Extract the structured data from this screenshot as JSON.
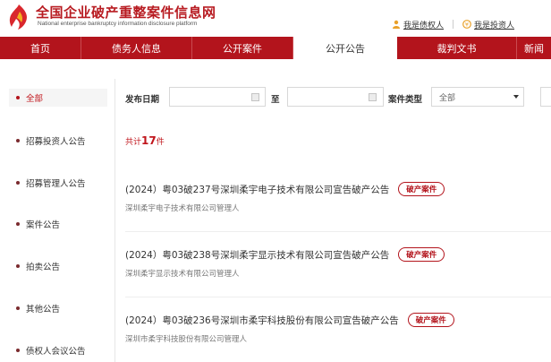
{
  "header": {
    "title": "全国企业破产重整案件信息网",
    "subtitle": "National enterprise bankruptcy information disclosure platform",
    "links": [
      {
        "label": "我是债权人",
        "icon": "user-icon"
      },
      {
        "label": "我是投资人",
        "icon": "investor-icon"
      }
    ]
  },
  "nav": {
    "items": [
      {
        "label": "首页",
        "active": false
      },
      {
        "label": "债务人信息",
        "active": false
      },
      {
        "label": "公开案件",
        "active": false
      },
      {
        "label": "公开公告",
        "active": true
      },
      {
        "label": "裁判文书",
        "active": false
      },
      {
        "label": "新闻",
        "active": false
      }
    ]
  },
  "sidebar": {
    "items": [
      {
        "label": "全部",
        "active": true
      },
      {
        "label": "招募投资人公告",
        "active": false
      },
      {
        "label": "招募管理人公告",
        "active": false
      },
      {
        "label": "案件公告",
        "active": false
      },
      {
        "label": "拍卖公告",
        "active": false
      },
      {
        "label": "其他公告",
        "active": false
      },
      {
        "label": "债权人会议公告",
        "active": false
      }
    ]
  },
  "filters": {
    "date_label": "发布日期",
    "to_label": "至",
    "type_label": "案件类型",
    "type_selected": "全部",
    "start_value": "",
    "end_value": ""
  },
  "summary": {
    "prefix": "共计",
    "count": "17",
    "suffix": "件"
  },
  "results": [
    {
      "title": "(2024）粤03破237号深圳柔宇电子技术有限公司宣告破产公告",
      "badge": "破产案件",
      "subtitle": "深圳柔宇电子技术有限公司管理人"
    },
    {
      "title": "(2024）粤03破238号深圳柔宇显示技术有限公司宣告破产公告",
      "badge": "破产案件",
      "subtitle": "深圳柔宇显示技术有限公司管理人"
    },
    {
      "title": "(2024）粤03破236号深圳市柔宇科技股份有限公司宣告破产公告",
      "badge": "破产案件",
      "subtitle": "深圳市柔宇科技股份有限公司管理人"
    }
  ],
  "colors": {
    "brand_red": "#b3141c",
    "accent_gold": "#e9a12a"
  }
}
